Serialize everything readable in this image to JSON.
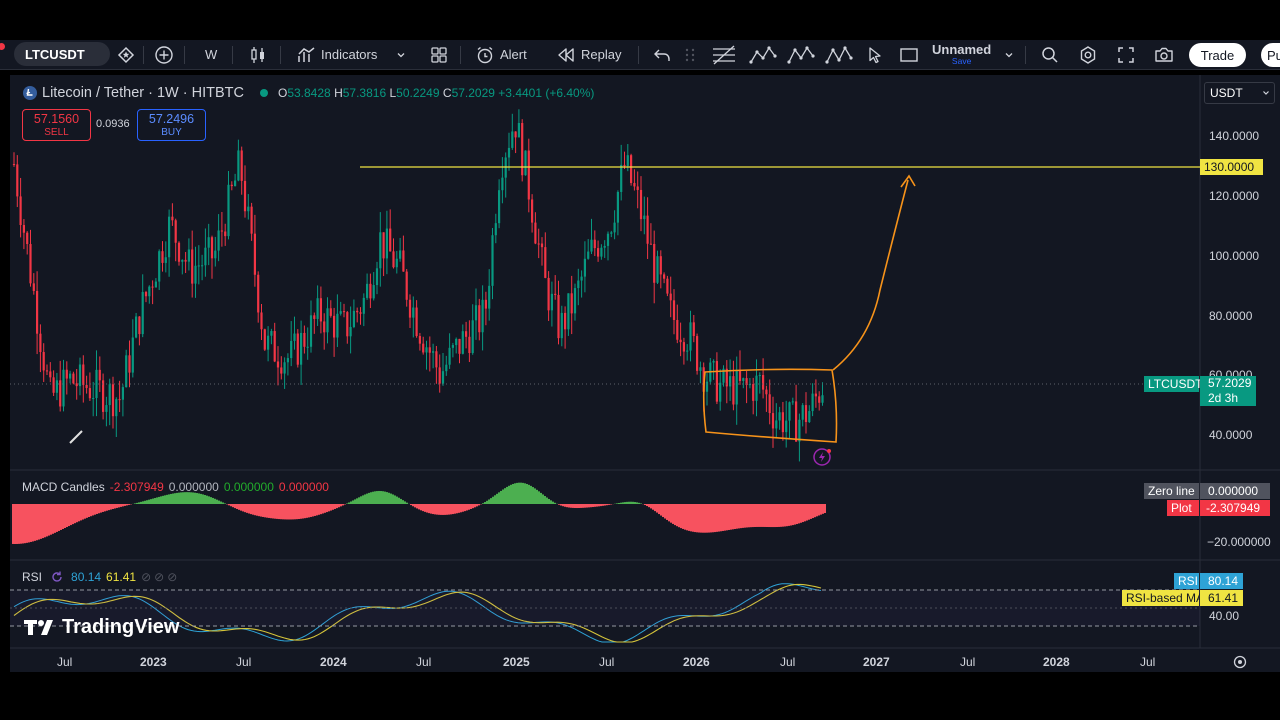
{
  "toolbar": {
    "symbol": "LTCUSDT",
    "interval": "W",
    "indicators_label": "Indicators",
    "alert_label": "Alert",
    "replay_label": "Replay",
    "layout_name": "Unnamed",
    "layout_save": "Save",
    "trade_label": "Trade",
    "publish_label": "Pu"
  },
  "legend": {
    "title": "Litecoin / Tether · 1W · HITBTC",
    "open_key": "O",
    "open": "53.8428",
    "high_key": "H",
    "high": "57.3816",
    "low_key": "L",
    "low": "50.2249",
    "close_key": "C",
    "close": "57.2029",
    "change": "+3.4401 (+6.40%)"
  },
  "currency": "USDT",
  "trade_panel": {
    "sell_price": "57.1560",
    "sell_label": "SELL",
    "spread": "0.0936",
    "buy_price": "57.2496",
    "buy_label": "BUY"
  },
  "price_axis": {
    "labels": [
      "140.0000",
      "120.0000",
      "100.0000",
      "80.0000",
      "60.0000",
      "40.0000"
    ],
    "hline_label": "130.0000",
    "current_symbol": "LTCUSDT",
    "current_price": "57.2029",
    "countdown": "2d 3h"
  },
  "macd": {
    "name": "MACD Candles",
    "v1": "-2.307949",
    "v2": "0.000000",
    "v3": "0.000000",
    "v4": "0.000000",
    "zero_label": "Zero line",
    "zero_value": "0.000000",
    "plot_label": "Plot",
    "plot_value": "-2.307949",
    "axis_label": "−20.000000"
  },
  "rsi": {
    "name": "RSI",
    "value": "80.14",
    "ma": "61.41",
    "rsi_label": "RSI",
    "ma_label": "RSI-based MA",
    "axis_label": "40.00"
  },
  "watermark": "TradingView",
  "time_axis": [
    "Jul",
    "2023",
    "Jul",
    "2024",
    "Jul",
    "2025",
    "Jul",
    "2026",
    "Jul",
    "2027",
    "Jul",
    "2028",
    "Jul"
  ],
  "colors": {
    "up": "#089981",
    "down": "#f23645",
    "hline": "#f0e442",
    "annotation": "#f7931a",
    "rsi_line": "#2ea3d6",
    "rsi_ma": "#d4c43a",
    "background": "#131722",
    "accent": "#2962ff"
  },
  "icons": [
    "favorite-icon",
    "add-symbol-icon",
    "bar-style-icon",
    "indicators-icon",
    "templates-icon",
    "alert-icon",
    "replay-icon",
    "undo-icon",
    "search-icon",
    "settings-icon",
    "fullscreen-icon",
    "camera-icon",
    "clock-icon",
    "pencil-icon",
    "drawing-tools-icon",
    "pattern-tools-icon",
    "cursor-icon",
    "rectangle-icon"
  ]
}
